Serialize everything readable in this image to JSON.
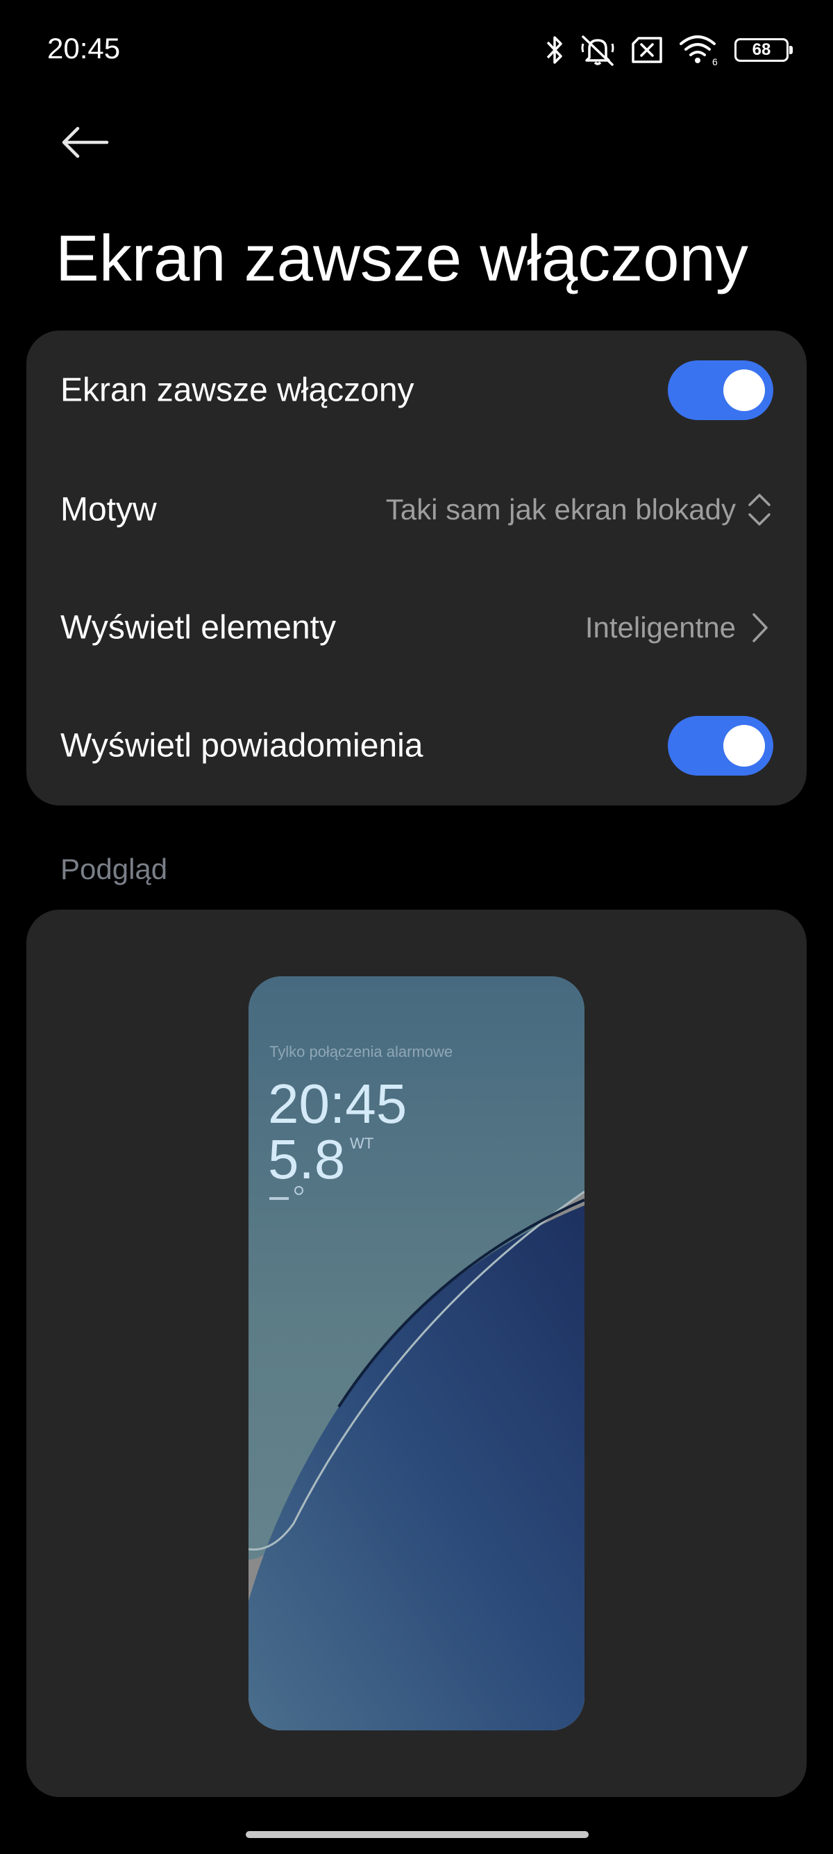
{
  "status_bar": {
    "time": "20:45",
    "battery": "68",
    "icons": [
      "bluetooth-icon",
      "ringer-off-icon",
      "no-sim-icon",
      "wifi-icon",
      "battery-icon"
    ]
  },
  "header": {
    "title": "Ekran zawsze włączony"
  },
  "settings": {
    "aod_toggle": {
      "label": "Ekran zawsze włączony",
      "on": true
    },
    "theme": {
      "label": "Motyw",
      "value": "Taki sam jak ekran blokady"
    },
    "display_elements": {
      "label": "Wyświetl elementy",
      "value": "Inteligentne"
    },
    "notifications_toggle": {
      "label": "Wyświetl powiadomienia",
      "on": true
    }
  },
  "preview": {
    "section_label": "Podgląd",
    "status_text": "Tylko połączenia alarmowe",
    "time": "20:45",
    "date": "5.8",
    "weekday": "WT"
  },
  "colors": {
    "accent": "#3a73f0",
    "card_bg": "#262626",
    "background": "#000000"
  }
}
